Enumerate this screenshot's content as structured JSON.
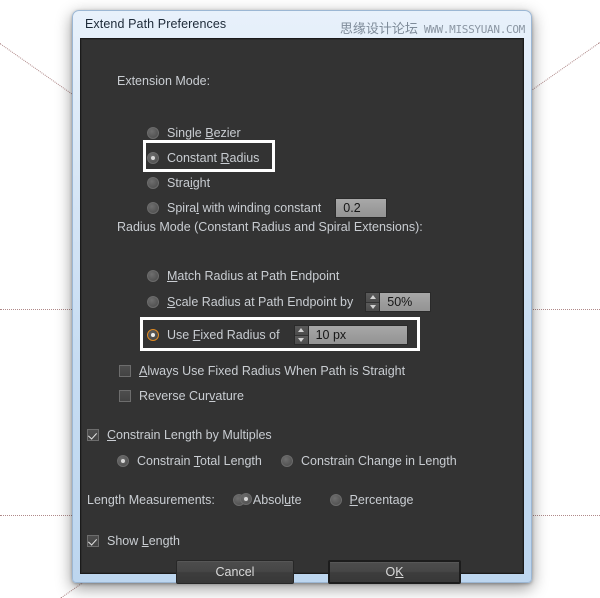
{
  "window": {
    "title": "Extend Path Preferences"
  },
  "watermark": {
    "cn": "思缘设计论坛",
    "url": "WWW.MISSYUAN.COM"
  },
  "sections": {
    "extension_mode": {
      "label": "Extension Mode:",
      "options": [
        {
          "label": "Single Bezier",
          "mnemonic": "B",
          "selected": false
        },
        {
          "label": "Constant Radius",
          "mnemonic": "R",
          "selected": true,
          "highlighted": true
        },
        {
          "label": "Straight",
          "mnemonic": "i",
          "selected": false
        },
        {
          "label": "Spiral with winding constant",
          "mnemonic": "l",
          "selected": false
        }
      ],
      "winding_constant_value": "0.2"
    },
    "radius_mode": {
      "label": "Radius Mode (Constant Radius and Spiral Extensions):",
      "options": [
        {
          "label": "Match Radius at Path Endpoint",
          "mnemonic": "M",
          "selected": false
        },
        {
          "label": "Scale Radius at Path Endpoint by",
          "mnemonic": "S",
          "selected": false
        },
        {
          "label": "Use Fixed Radius of",
          "mnemonic": "F",
          "selected": true,
          "highlighted": true
        }
      ],
      "scale_value": "50%",
      "fixed_radius_value": "10 px"
    },
    "checkboxes": [
      {
        "label": "Always Use Fixed Radius When Path is Straight",
        "mnemonic": "A",
        "checked": false
      },
      {
        "label": "Reverse Curvature",
        "mnemonic": "v",
        "checked": false
      }
    ],
    "constrain": {
      "label": "Constrain Length by Multiples",
      "mnemonic": "C",
      "checked": true,
      "options": [
        {
          "label": "Constrain Total Length",
          "mnemonic": "T",
          "selected": true
        },
        {
          "label": "Constrain Change in Length",
          "mnemonic": "g",
          "selected": false
        }
      ]
    },
    "length_measurements": {
      "label": "Length Measurements:",
      "options": [
        {
          "label": "Absolute",
          "mnemonic": "u",
          "selected": true
        },
        {
          "label": "Percentage",
          "mnemonic": "P",
          "selected": false
        }
      ]
    },
    "show_length": {
      "label": "Show Length",
      "mnemonic": "L",
      "checked": true
    }
  },
  "buttons": {
    "cancel": "Cancel",
    "ok": "OK"
  },
  "colors": {
    "panel_bg": "#333333",
    "accent_orange": "#e08a22",
    "highlight_white": "#ffffff",
    "text": "#c9cdd2"
  }
}
